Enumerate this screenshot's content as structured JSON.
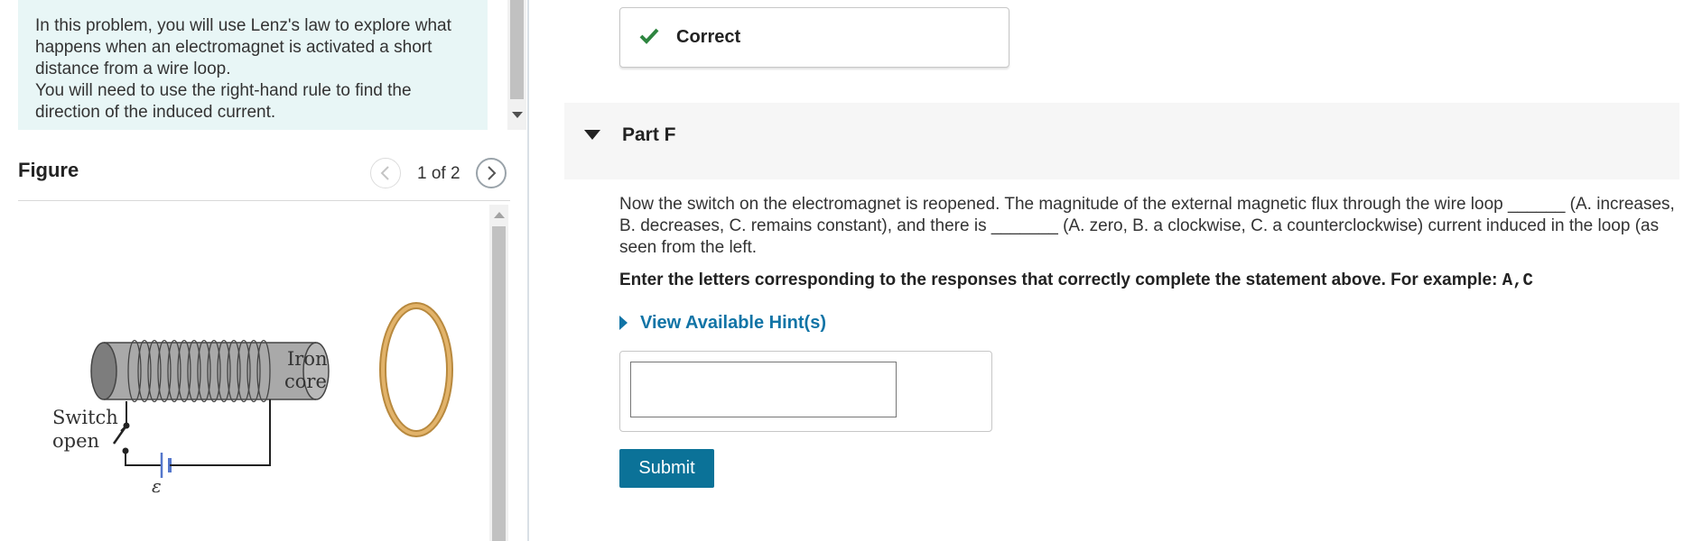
{
  "intro": {
    "line1": "In this problem, you will use Lenz's law to explore what happens when an electromagnet is activated a short distance from a wire loop.",
    "line2": "You will need to use the right-hand rule to find the direction of the induced current."
  },
  "figure": {
    "title": "Figure",
    "pager": "1 of 2",
    "labels": {
      "iron": "Iron",
      "core": "core",
      "switch": "Switch",
      "open": "open",
      "emf": "ε"
    }
  },
  "feedback": {
    "status": "Correct",
    "icon": "check-icon",
    "color": "#2e8540"
  },
  "part": {
    "title": "Part F",
    "question": "Now the switch on the electromagnet is reopened. The magnitude of the external magnetic flux through the wire loop ______ (A. increases, B. decreases, C. remains constant), and there is _______ (A. zero, B. a clockwise, C. a counterclockwise) current induced in the loop (as seen from the left.",
    "instruction": "Enter the letters corresponding to the responses that correctly complete the statement above. For example: ",
    "example": "A,C",
    "hint": "View Available Hint(s)",
    "answer_value": "",
    "submit": "Submit"
  },
  "colors": {
    "accent": "#0b7298",
    "hint": "#1174a6",
    "intro_bg": "#e8f6f6"
  }
}
